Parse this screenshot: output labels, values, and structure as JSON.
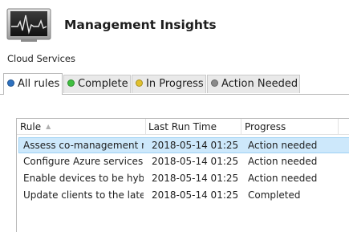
{
  "header": {
    "title": "Management Insights",
    "icon": "monitor-heartbeat-icon"
  },
  "breadcrumb": "Cloud Services",
  "tabs": [
    {
      "label": "All rules",
      "dot_color": "#2f72c0",
      "active": true
    },
    {
      "label": "Complete",
      "dot_color": "#3fbf3f",
      "active": false
    },
    {
      "label": "In Progress",
      "dot_color": "#e1c12e",
      "active": false
    },
    {
      "label": "Action Needed",
      "dot_color": "#8a8a8a",
      "active": false
    }
  ],
  "table": {
    "columns": [
      "Rule",
      "Last Run Time",
      "Progress"
    ],
    "sort_column": "Rule",
    "rows": [
      {
        "rule": "Assess co-management re...",
        "last_run": "2018-05-14 01:25",
        "progress": "Action needed",
        "selected": true
      },
      {
        "rule": "Configure Azure services f...",
        "last_run": "2018-05-14 01:25",
        "progress": "Action needed",
        "selected": false
      },
      {
        "rule": "Enable devices to be hybri...",
        "last_run": "2018-05-14 01:25",
        "progress": "Action needed",
        "selected": false
      },
      {
        "rule": "Update clients to the lates...",
        "last_run": "2018-05-14 01:25",
        "progress": "Completed",
        "selected": false
      }
    ]
  },
  "colors": {
    "selected_row": "#cde8fb",
    "tab_background": "#e9e9e9"
  }
}
